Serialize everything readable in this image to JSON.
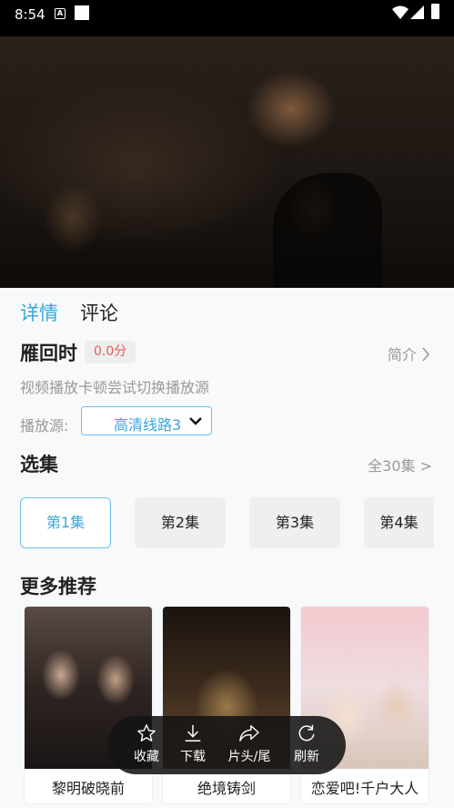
{
  "status_bar": {
    "time": "8:54",
    "notification_letter": "A"
  },
  "tabs": [
    {
      "label": "详情"
    },
    {
      "label": "评论"
    }
  ],
  "show": {
    "title": "雁回时",
    "score": "0.0分",
    "intro_label": "简介",
    "hint": "视频播放卡顿尝试切换播放源",
    "source_label": "播放源:",
    "source_selected": "高清线路3"
  },
  "episodes": {
    "section_title": "选集",
    "all_label": "全30集 >",
    "items": [
      {
        "label": "第1集"
      },
      {
        "label": "第2集"
      },
      {
        "label": "第3集"
      },
      {
        "label": "第4集"
      }
    ]
  },
  "recommend": {
    "section_title": "更多推荐",
    "items": [
      {
        "title": "黎明破晓前"
      },
      {
        "title": "绝境铸剑"
      },
      {
        "title": "恋爱吧!千户大人"
      }
    ]
  },
  "actions": [
    {
      "label": "收藏",
      "icon": "star-icon"
    },
    {
      "label": "下载",
      "icon": "download-icon"
    },
    {
      "label": "片头/尾",
      "icon": "share-forward-icon"
    },
    {
      "label": "刷新",
      "icon": "refresh-icon"
    }
  ],
  "colors": {
    "accent": "#3aa6dc",
    "score": "#e55a5a"
  }
}
